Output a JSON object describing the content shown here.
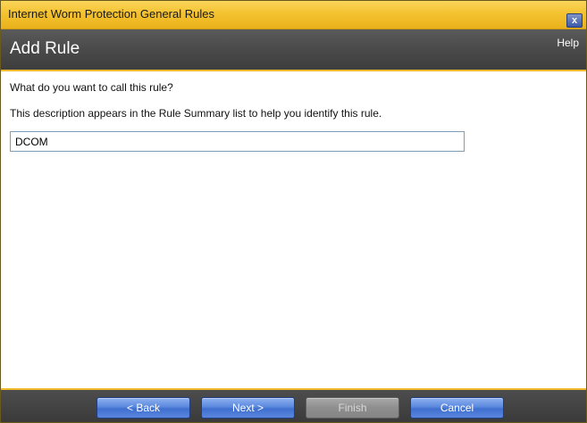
{
  "window": {
    "title": "Internet Worm Protection General Rules",
    "close_glyph": "x"
  },
  "header": {
    "title": "Add Rule",
    "help_label": "Help"
  },
  "main": {
    "question": "What do you want to call this rule?",
    "description": "This description appears in the Rule Summary list to help you identify this rule.",
    "rule_name_value": "DCOM"
  },
  "footer": {
    "back_label": "< Back",
    "next_label": "Next >",
    "finish_label": "Finish",
    "cancel_label": "Cancel"
  },
  "colors": {
    "title_bar": "#f4c230",
    "header_bg": "#4a4a4a",
    "accent": "#f1b92b",
    "button_blue": "#5b88de",
    "button_disabled": "#8e8e8e"
  },
  "icons": {
    "close": "close-icon"
  }
}
